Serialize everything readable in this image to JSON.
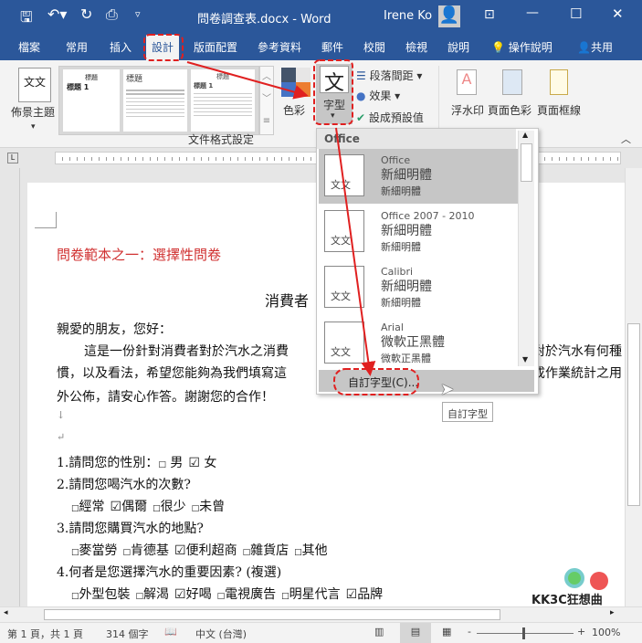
{
  "titlebar": {
    "title": "問卷調查表.docx - Word",
    "user": "Irene Ko",
    "icons": [
      "save-icon",
      "undo-icon",
      "redo-icon",
      "print-preview-icon",
      "customize-icon",
      "ribbon-display-icon",
      "minimize-icon",
      "maximize-icon",
      "close-icon"
    ]
  },
  "tabs": [
    "檔案",
    "常用",
    "插入",
    "設計",
    "版面配置",
    "參考資料",
    "郵件",
    "校閱",
    "檢視",
    "說明",
    "操作說明",
    "共用"
  ],
  "active_tab": "設計",
  "ribbon": {
    "themes": "佈景主題",
    "style_thumbs": [
      "標題",
      "標題 1",
      "標題",
      "標題",
      "標題 1"
    ],
    "colors": "色彩",
    "fonts": "字型",
    "paragraph_spacing": "段落間距",
    "effects": "效果",
    "set_default": "設成預設值",
    "watermark": "浮水印",
    "page_color": "頁面色彩",
    "page_borders": "頁面框線",
    "group_label": "文件格式設定",
    "color_swatches": [
      "#44546a",
      "#e7e6e6",
      "#4472c4",
      "#ed7d31"
    ]
  },
  "dropdown": {
    "header": "Office",
    "items": [
      {
        "name": "Office",
        "heading": "新細明體",
        "body": "新細明體",
        "thumb": "文文"
      },
      {
        "name": "Office 2007 - 2010",
        "heading": "新細明體",
        "body": "新細明體",
        "thumb": "文文"
      },
      {
        "name": "Calibri",
        "heading": "新細明體",
        "body": "新細明體",
        "thumb": "文文"
      },
      {
        "name": "Arial",
        "heading": "微軟正黑體",
        "body": "微軟正黑體",
        "thumb": "文文"
      }
    ],
    "custom": "自訂字型(C)...",
    "tooltip": "自訂字型"
  },
  "document": {
    "title": "問卷範本之一：選擇性問卷",
    "subtitle": "消費者",
    "greeting": "親愛的朋友，您好：",
    "p1_left": "這是一份針對消費者對於汽水之消費",
    "p1_right": "對於汽水有何種",
    "p2_left": "慣，以及看法，希望您能夠為我們填寫這",
    "p2_right": "成作業統計之用",
    "p3": "外公佈，請安心作答。謝謝您的合作！",
    "q1": "1.請問您的性別：",
    "q1_opts": [
      {
        "label": "男",
        "checked": false
      },
      {
        "label": "女",
        "checked": true
      }
    ],
    "q2": "2.請問您喝汽水的次數?",
    "q2_opts": [
      {
        "label": "經常",
        "checked": false
      },
      {
        "label": "偶爾",
        "checked": true
      },
      {
        "label": "很少",
        "checked": false
      },
      {
        "label": "未曾",
        "checked": false
      }
    ],
    "q3": "3.請問您購買汽水的地點?",
    "q3_opts": [
      {
        "label": "麥當勞",
        "checked": false
      },
      {
        "label": "肯德基",
        "checked": false
      },
      {
        "label": "便利超商",
        "checked": true
      },
      {
        "label": "雜貨店",
        "checked": false
      },
      {
        "label": "其他",
        "checked": false
      }
    ],
    "q4": "4.何者是您選擇汽水的重要因素? (複選)",
    "q4_opts": [
      {
        "label": "外型包裝",
        "checked": false
      },
      {
        "label": "解渴",
        "checked": false
      },
      {
        "label": "好喝",
        "checked": true
      },
      {
        "label": "電視廣告",
        "checked": false
      },
      {
        "label": "明星代言",
        "checked": false
      },
      {
        "label": "品牌",
        "checked": true
      }
    ]
  },
  "status": {
    "page": "第 1 頁，共 1 頁",
    "words": "314 個字",
    "language": "中文 (台灣)",
    "zoom": "100%",
    "zoom_level_percent": 100
  },
  "watermark_logo": "KK3C狂想曲",
  "accent": "#2b579a",
  "annotation_color": "#e02020"
}
